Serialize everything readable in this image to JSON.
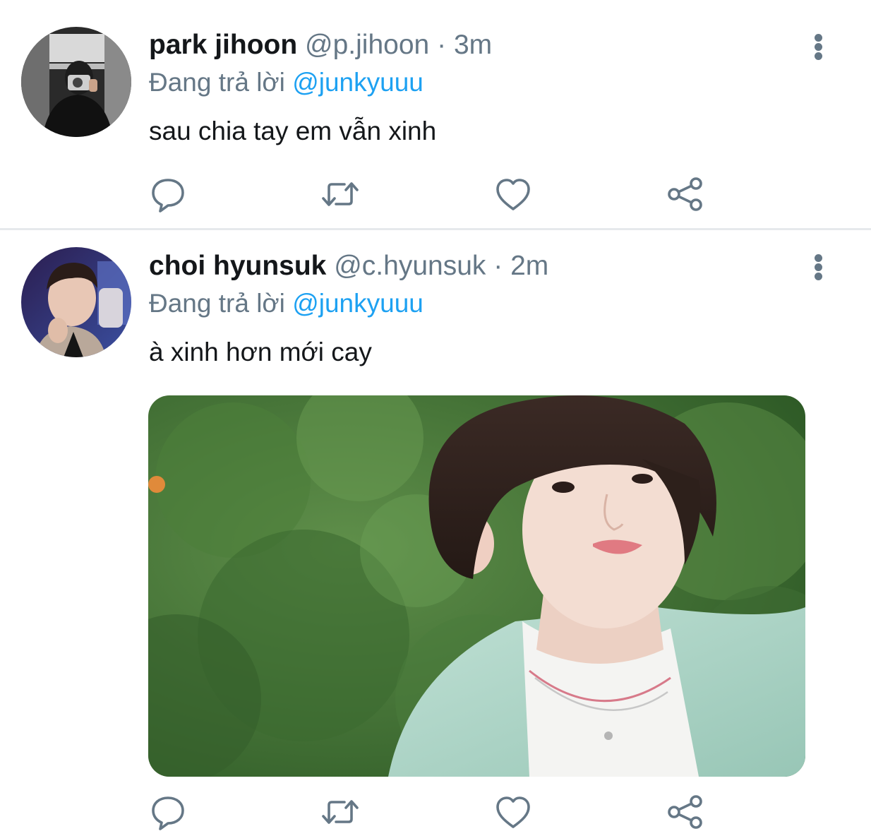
{
  "tweets": [
    {
      "name": "park jihoon",
      "handle": "@p.jihoon",
      "separator": "·",
      "time": "3m",
      "reply_prefix": "Đang trả lời",
      "reply_to": "@junkyuuu",
      "text": "sau chia tay em vẫn xinh",
      "avatar_icon": "profile-photo"
    },
    {
      "name": "choi hyunsuk",
      "handle": "@c.hyunsuk",
      "separator": "·",
      "time": "2m",
      "reply_prefix": "Đang trả lời",
      "reply_to": "@junkyuuu",
      "text": "à xinh hơn mới cay",
      "avatar_icon": "profile-photo",
      "media_icon": "attached-photo"
    }
  ],
  "icons": {
    "more": "more-vertical-icon",
    "reply": "comment-icon",
    "retweet": "retweet-icon",
    "like": "heart-icon",
    "share": "share-icon"
  },
  "colors": {
    "text": "#14171a",
    "secondary": "#657786",
    "mention": "#1da1f2",
    "separator": "#e6e9ec"
  }
}
